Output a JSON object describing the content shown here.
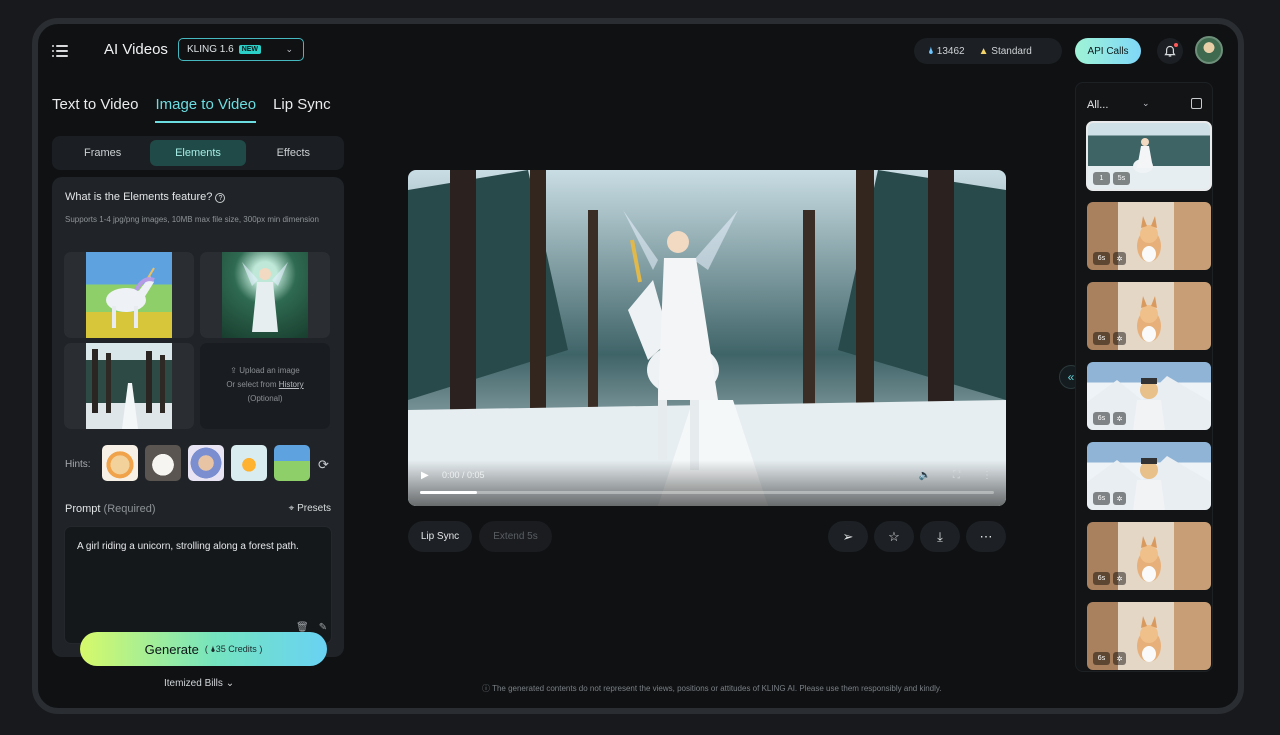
{
  "header": {
    "app_title": "AI Videos",
    "model": "KLING 1.6",
    "model_badge": "NEW",
    "credits": "13462",
    "plan": "Standard",
    "api_button": "API Calls"
  },
  "mode_tabs": [
    {
      "label": "Text to Video",
      "active": false
    },
    {
      "label": "Image to Video",
      "active": true
    },
    {
      "label": "Lip Sync",
      "active": false
    }
  ],
  "sub_tabs": [
    {
      "label": "Frames",
      "active": false
    },
    {
      "label": "Elements",
      "active": true
    },
    {
      "label": "Effects",
      "active": false
    }
  ],
  "elements": {
    "question": "What is the Elements feature?",
    "note": "Supports 1-4 jpg/png images, 10MB max file size, 300px min dimension",
    "upload_line1": "Upload an image",
    "upload_line2": "Or select from",
    "upload_link": "History",
    "upload_line3": "(Optional)",
    "hints_label": "Hints:"
  },
  "prompt": {
    "label": "Prompt",
    "required": "(Required)",
    "presets": "Presets",
    "value": "A girl riding a unicorn, strolling along a forest path."
  },
  "generate": {
    "label": "Generate",
    "credits": "35 Credits",
    "bills": "Itemized Bills"
  },
  "video": {
    "time": "0:00 / 0:05",
    "progress": 0.1
  },
  "actions": {
    "lip_sync": "Lip Sync",
    "extend": "Extend 5s"
  },
  "disclaimer": "The generated contents do not represent the views, positions or attitudes of KLING AI. Please use them responsibly and kindly.",
  "history": {
    "filter": "All...",
    "items": [
      {
        "duration": "1",
        "label": "5s",
        "scene": "unicorn-forest",
        "selected": true
      },
      {
        "duration": "6s",
        "scene": "corgi-room"
      },
      {
        "duration": "6s",
        "scene": "corgi-room"
      },
      {
        "duration": "6s",
        "scene": "cat-mountains"
      },
      {
        "duration": "6s",
        "scene": "cat-mountains"
      },
      {
        "duration": "6s",
        "scene": "corgi-room"
      },
      {
        "duration": "6s",
        "scene": "corgi-room"
      }
    ]
  },
  "colors": {
    "accent": "#6cdde0",
    "generate_start": "#d7f96a",
    "generate_end": "#69d2f4",
    "panel": "#202428",
    "background": "#0f1113"
  }
}
